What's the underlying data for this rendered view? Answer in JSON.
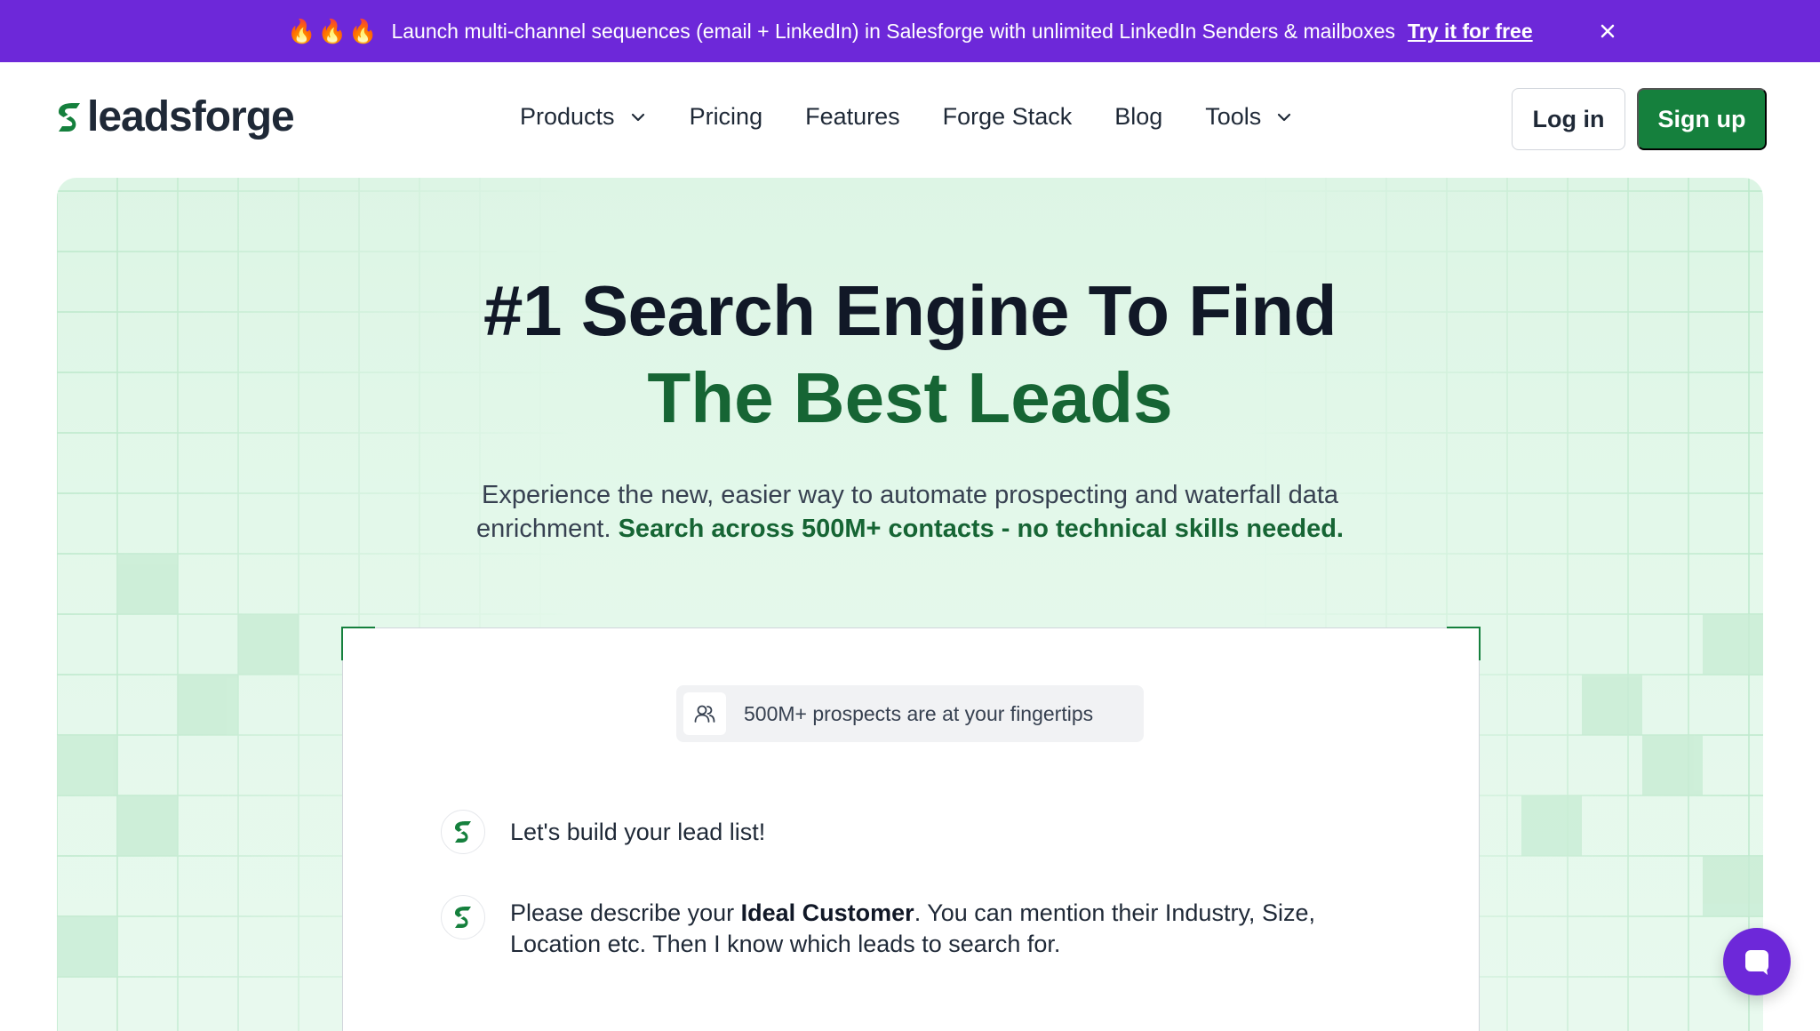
{
  "announcement": {
    "fires": "🔥🔥🔥",
    "message": "Launch multi-channel sequences (email + LinkedIn) in Salesforge with unlimited LinkedIn Senders & mailboxes",
    "cta": "Try it for free"
  },
  "header": {
    "logo_text": "leadsforge",
    "nav": [
      {
        "label": "Products",
        "has_dropdown": true
      },
      {
        "label": "Pricing",
        "has_dropdown": false
      },
      {
        "label": "Features",
        "has_dropdown": false
      },
      {
        "label": "Forge Stack",
        "has_dropdown": false
      },
      {
        "label": "Blog",
        "has_dropdown": false
      },
      {
        "label": "Tools",
        "has_dropdown": true
      }
    ],
    "login_label": "Log in",
    "signup_label": "Sign up"
  },
  "hero": {
    "title_line1": "#1 Search Engine To Find",
    "title_line2": "The Best Leads",
    "subtitle_plain": "Experience the new, easier way to automate prospecting and waterfall data enrichment. ",
    "subtitle_highlight": "Search across 500M+ contacts - no technical skills needed."
  },
  "card": {
    "chip_text": "500M+ prospects are at your fingertips",
    "message1": "Let's build your lead list!",
    "message2_pre": "Please describe your ",
    "message2_bold": "Ideal Customer",
    "message2_post": ". You can mention their Industry, Size, Location etc. Then I know which leads to search for."
  },
  "colors": {
    "announce_bg": "#6d28d9",
    "brand_green": "#15803d",
    "dark_green": "#166534",
    "hero_bg": "#e3f8ea"
  },
  "icons": [
    "close-icon",
    "chevron-down-icon",
    "users-icon",
    "leadsforge-logo-icon",
    "chat-icon"
  ]
}
